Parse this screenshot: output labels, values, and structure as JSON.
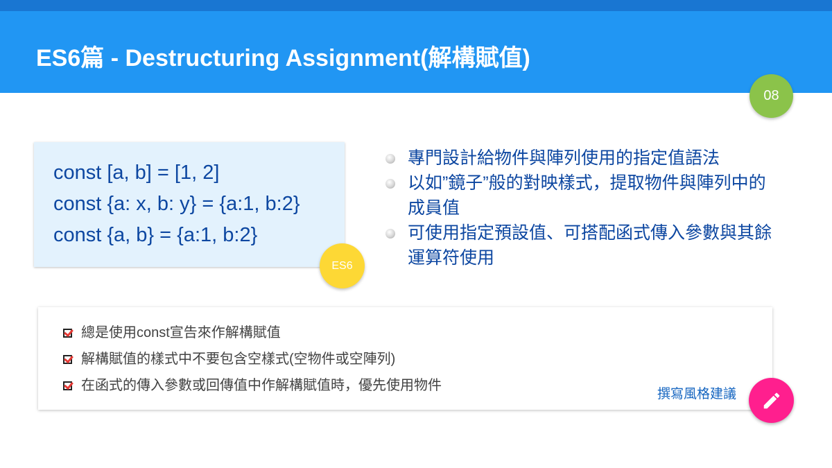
{
  "header": {
    "title": "ES6篇 - Destructuring Assignment(解構賦值)",
    "page_number": "08"
  },
  "code_card": {
    "lines": [
      "const [a, b] = [1, 2]",
      "const {a: x, b: y} = {a:1, b:2}",
      "const {a, b} = {a:1, b:2}"
    ],
    "badge": "ES6"
  },
  "bullets": [
    "專門設計給物件與陣列使用的指定值語法",
    "以如”鏡子”般的對映樣式，提取物件與陣列中的成員值",
    "可使用指定預設值、可搭配函式傳入參數與其餘運算符使用"
  ],
  "style_guide": {
    "items": [
      "總是使用const宣告來作解構賦值",
      "解構賦值的樣式中不要包含空樣式(空物件或空陣列)",
      "在函式的傳入參數或回傳值中作解構賦值時，優先使用物件"
    ],
    "link_label": "撰寫風格建議"
  },
  "colors": {
    "header": "#2196f3",
    "header_strip": "#1976d2",
    "page_badge": "#8bc34a",
    "es6_badge": "#fdd835",
    "code_bg": "#e3f2fd",
    "code_text": "#0d47a1",
    "fab": "#ff1f8e"
  },
  "icons": {
    "fab": "pencil-icon",
    "bullet": "bullet-dot-icon",
    "check": "checkbox-checked-icon"
  }
}
